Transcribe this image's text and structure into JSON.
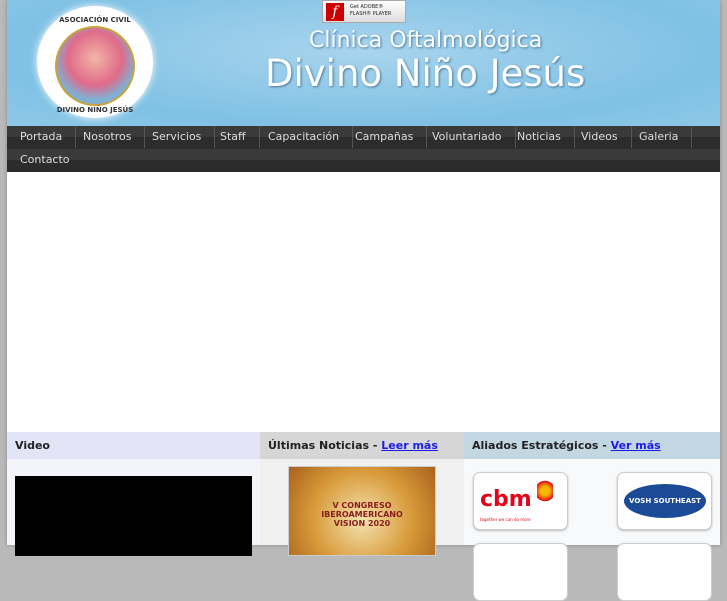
{
  "header": {
    "title_line1": "Clínica Oftalmológica",
    "title_line2": "Divino Niño Jesús",
    "logo_text_top": "ASOCIACIÓN CIVIL",
    "logo_text_bottom": "DIVINO NIÑO JESÚS",
    "flash_badge": {
      "line1": "Get ADOBE®",
      "line2": "FLASH® PLAYER"
    }
  },
  "nav": {
    "items": [
      "Portada",
      "Nosotros",
      "Servicios",
      "Staff",
      "Capacitación",
      "Campañas",
      "Voluntariado",
      "Noticias",
      "Videos",
      "Galeria",
      "Contacto"
    ]
  },
  "sections": {
    "video": {
      "title": "Video"
    },
    "news": {
      "title": "Últimas Noticias - ",
      "link": "Leer más",
      "image_text": "V CONGRESO IBEROAMERICANO VISION 2020"
    },
    "allies": {
      "title": "Aliados Estratégicos - ",
      "link": "Ver más",
      "logos": [
        "cbm",
        "VOSH SOUTHEAST"
      ],
      "cbm_tagline": "together we can do more"
    }
  },
  "colors": {
    "nav": "#333333",
    "header": "#8ec8e7",
    "link": "#1a1aee"
  }
}
